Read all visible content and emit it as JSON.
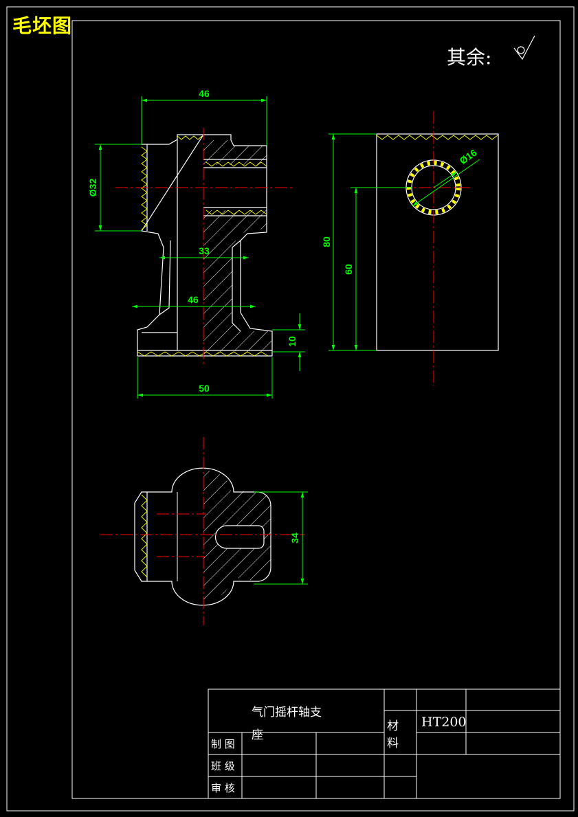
{
  "title": "毛坯图",
  "roughness_note": "其余:",
  "colors": {
    "background": "#000000",
    "outline": "#ffffff",
    "dimension": "#00ff00",
    "centerline": "#ff0000",
    "hatch": "#ffff00",
    "title": "#ffff00"
  },
  "dimensions": {
    "top_width": "46",
    "bore_dia": "Ø32",
    "neck_width": "33",
    "mid_width": "46",
    "base_height": "10",
    "base_width": "50",
    "total_height": "80",
    "center_height": "60",
    "hole_dia": "Ø16",
    "bottom_height": "34"
  },
  "title_block": {
    "part_name_line1": "气门摇杆轴支",
    "part_name_line2": "座",
    "material_label_1": "材",
    "material_label_2": "料",
    "material_value": "HT200",
    "drawn_by": "制 图",
    "class": "班 级",
    "review": "审 核"
  }
}
